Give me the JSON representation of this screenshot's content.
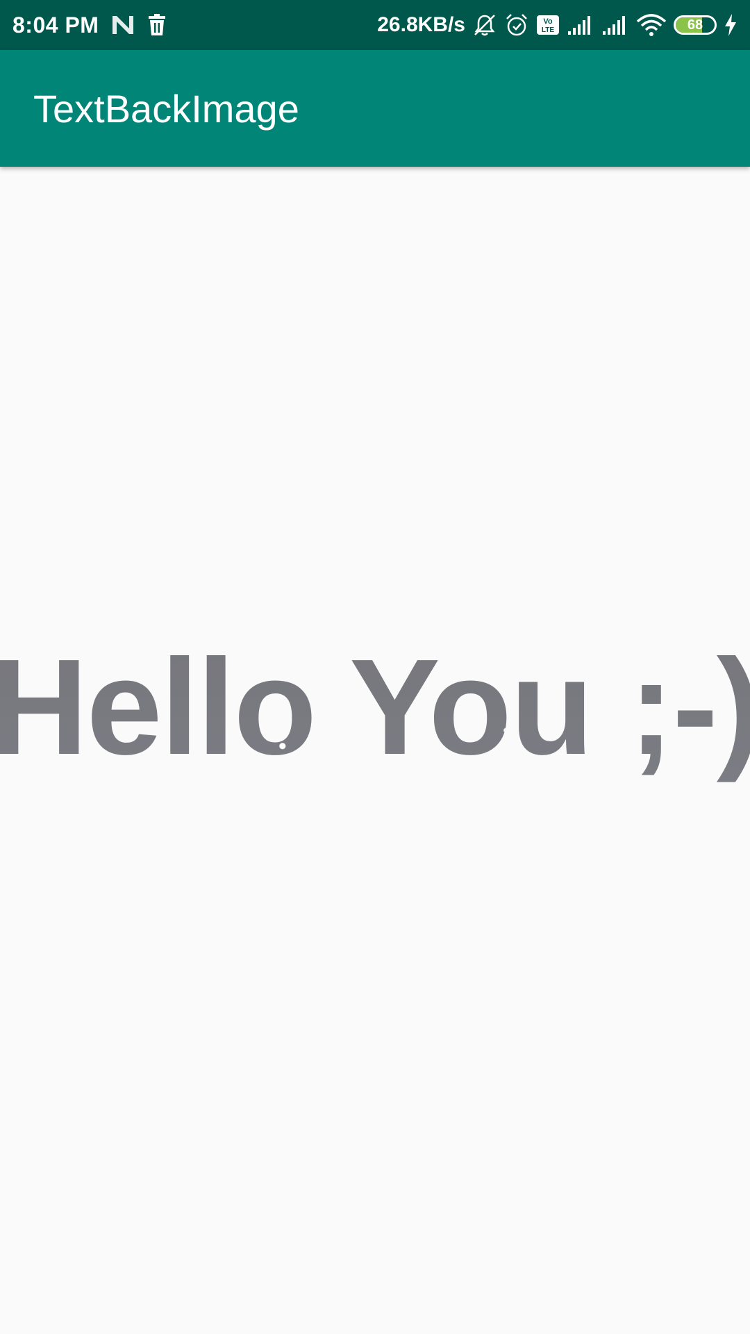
{
  "status_bar": {
    "time": "8:04 PM",
    "net_speed": "26.8KB/s",
    "battery_level": "68",
    "battery_fraction": 0.68,
    "icons": [
      "n-logo-icon",
      "trash-icon",
      "mute-bell-icon",
      "alarm-icon",
      "volte-icon",
      "signal-icon",
      "signal-icon",
      "wifi-icon",
      "battery-icon",
      "charging-icon"
    ],
    "colors": {
      "background": "#00574b",
      "battery_fill": "#8bc34a"
    }
  },
  "app_bar": {
    "title": "TextBackImage",
    "color": "#008577"
  },
  "main": {
    "text": "Hello You ;-)",
    "text_color": "#7a7a80",
    "background": "#fafafa"
  }
}
